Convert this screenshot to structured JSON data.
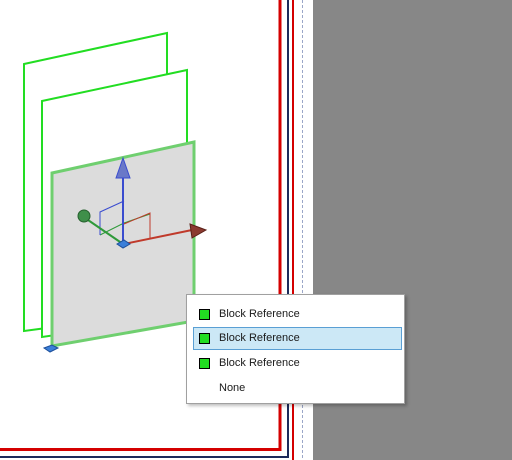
{
  "viewport": {
    "background_color": "#ffffff",
    "side_panel_color": "#878787"
  },
  "scene": {
    "frame_outline_color": "#d40000",
    "inner_rule_color": "#1c2a5a",
    "block_outline_color": "#22dd22",
    "selected_block_fill": "#dcdcdc",
    "gizmo": {
      "x_axis_color": "#c03a2b",
      "y_axis_color": "#2f9a3a",
      "z_axis_color": "#3a4ccf"
    }
  },
  "selection_popup": {
    "items": [
      {
        "label": "Block Reference",
        "swatch_color": "#22dd22",
        "selected": false
      },
      {
        "label": "Block Reference",
        "swatch_color": "#22dd22",
        "selected": true
      },
      {
        "label": "Block Reference",
        "swatch_color": "#22dd22",
        "selected": false
      },
      {
        "label": "None",
        "swatch_color": null,
        "selected": false
      }
    ]
  }
}
